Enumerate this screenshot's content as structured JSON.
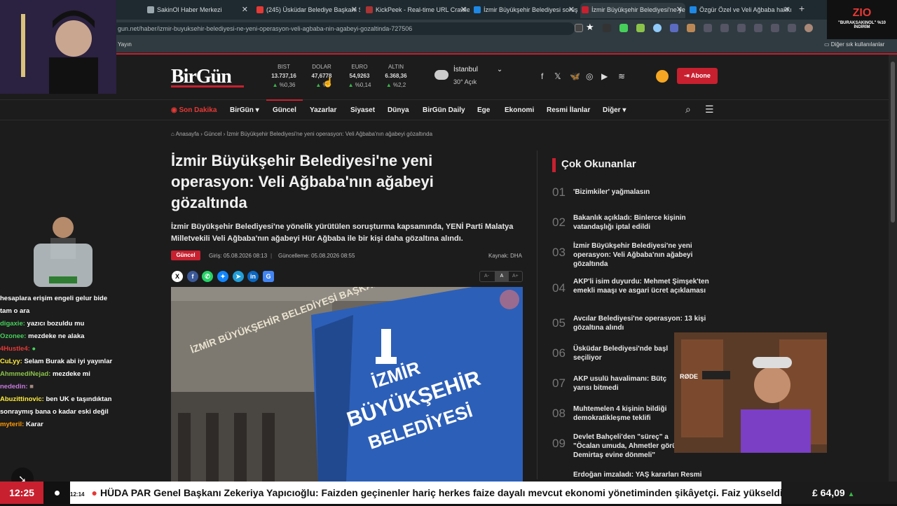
{
  "tabs": [
    {
      "label": "SakinOl Haber Merkezi",
      "fav": "#9aa7ad"
    },
    {
      "label": "(245) Üsküdar Belediye Başkanı S",
      "fav": "#e53935"
    },
    {
      "label": "KickPeek - Real-time URL Crawler",
      "fav": "#a33"
    },
    {
      "label": "İzmir Büyükşehir Belediyesi soruş",
      "fav": "#1e88e5"
    },
    {
      "label": "İzmir Büyükşehir Belediyesi'ne ye",
      "fav": "#c8202f"
    },
    {
      "label": "Özgür Özel ve Veli Ağbaba hakkı",
      "fav": "#1e88e5"
    }
  ],
  "url": "gun.net/haber/izmir-buyuksehir-belediyesi-ne-yeni-operasyon-veli-agbaba-nin-agabeyi-gozaltinda-727506",
  "bookmarks": {
    "left": "Yayın",
    "right": "Diğer sık kullanılanlar"
  },
  "site": {
    "logo": "BirGün",
    "subscribe": "Abone"
  },
  "markets": [
    {
      "name": "BIST",
      "value": "13.737,16",
      "change": "%0,36"
    },
    {
      "name": "DOLAR",
      "value": "47,6778",
      "change": "%"
    },
    {
      "name": "EURO",
      "value": "54,9263",
      "change": "%0,14"
    },
    {
      "name": "ALTIN",
      "value": "6.368,36",
      "change": "%2,2"
    }
  ],
  "weather": {
    "city": "İstanbul",
    "temp": "30° Açık"
  },
  "nav": [
    "Son Dakika",
    "BirGün",
    "Güncel",
    "Yazarlar",
    "Siyaset",
    "Dünya",
    "BirGün Daily",
    "Ege",
    "Ekonomi",
    "Resmi İlanlar",
    "Diğer"
  ],
  "breadcrumb": {
    "home": "Anasayfa",
    "section": "Güncel",
    "current": "İzmir Büyükşehir Belediyesi'ne yeni operasyon: Veli Ağbaba'nın ağabeyi gözaltında"
  },
  "article": {
    "title": "İzmir Büyükşehir Belediyesi'ne yeni operasyon: Veli Ağbaba'nın ağabeyi gözaltında",
    "lead": "İzmir Büyükşehir Belediyesi'ne yönelik yürütülen soruşturma kapsamında, YENİ Parti Malatya Milletvekili Veli Ağbaba'nın ağabeyi Hür Ağbaba ile bir kişi daha gözaltına alındı.",
    "badge": "Güncel",
    "published": "Giriş: 05.08.2026 08:13",
    "updated": "Güncelleme: 05.08.2026 08:55",
    "source": "Kaynak: DHA",
    "font_sizes": [
      "A-",
      "A",
      "A+"
    ],
    "photo_text": {
      "building": "İZMİR BÜYÜKŞEHİR BELEDİYESİ BAŞKANLIĞI",
      "flag_top": "İZMİR",
      "flag_mid": "BÜYÜKŞEHİR",
      "flag_bot": "BELEDİYESİ"
    }
  },
  "most_read": {
    "heading": "Çok Okunanlar",
    "items": [
      {
        "no": "01",
        "text": "'Bizimkiler' yağmalasın"
      },
      {
        "no": "02",
        "text": "Bakanlık açıkladı: Binlerce kişinin vatandaşlığı iptal edildi"
      },
      {
        "no": "03",
        "text": "İzmir Büyükşehir Belediyesi'ne yeni operasyon: Veli Ağbaba'nın ağabeyi gözaltında"
      },
      {
        "no": "04",
        "text": "AKP'li isim duyurdu: Mehmet Şimşek'ten emekli maaşı ve asgari ücret açıklaması"
      },
      {
        "no": "05",
        "text": "Avcılar Belediyesi'ne operasyon: 13 kişi gözaltına alındı"
      },
      {
        "no": "06",
        "text": "Üsküdar Belediyesi'nde başl seçiliyor"
      },
      {
        "no": "07",
        "text": "AKP usulü havalimanı: Bütç yarısı bitmedi"
      },
      {
        "no": "08",
        "text": "Muhtemelen 4 kişinin bildiği demokratikleşme teklifi"
      },
      {
        "no": "09",
        "text": "Devlet Bahçeli'den \"süreç\" a \"Öcalan umuda, Ahmetler görü Demirtaş evine dönmeli\""
      },
      {
        "no": "",
        "text": "Erdoğan imzaladı: YAŞ kararları Resmi"
      }
    ]
  },
  "chat": [
    {
      "user": "",
      "text": "hesaplara erişim engeli gelur bide tam o ara",
      "color": "#fff"
    },
    {
      "user": "digaxie:",
      "text": "yazıcı bozuldu mu",
      "color": "#46d05a"
    },
    {
      "user": "Ozonee:",
      "text": "mezdeke ne alaka",
      "color": "#46d05a"
    },
    {
      "user": "4Hustle4:",
      "text": "",
      "color": "#e53935"
    },
    {
      "user": "CuLyy:",
      "text": "Selam Burak abi iyi yayınlar",
      "color": "#ffeb3b"
    },
    {
      "user": "AhmmediNejad:",
      "text": "mezdeke mi",
      "color": "#8bc34a"
    },
    {
      "user": "nededin:",
      "text": "",
      "color": "#c678dd"
    },
    {
      "user": "Abuzittinovic:",
      "text": "ben UK e taşındıktan sonraymış bana o kadar eski değil",
      "color": "#ffeb3b"
    },
    {
      "user": "myteril:",
      "text": "Karar",
      "color": "#ff9800"
    }
  ],
  "overlay": {
    "zio": "ZIO",
    "promo": "\"BURAKSAKINOL\" %10 İNDİRİM",
    "mic": "RØDE"
  },
  "bottom": {
    "clock": "12:25",
    "ticker_time": "12:14",
    "ticker": "HÜDA PAR Genel Başkanı Zekeriya Yapıcıoğlu: Faizden geçinenler hariç herkes faize dayalı mevcut ekonomi yönetiminden şikâyetçi. Faiz yükseldi, p",
    "price": "£ 64,09"
  }
}
